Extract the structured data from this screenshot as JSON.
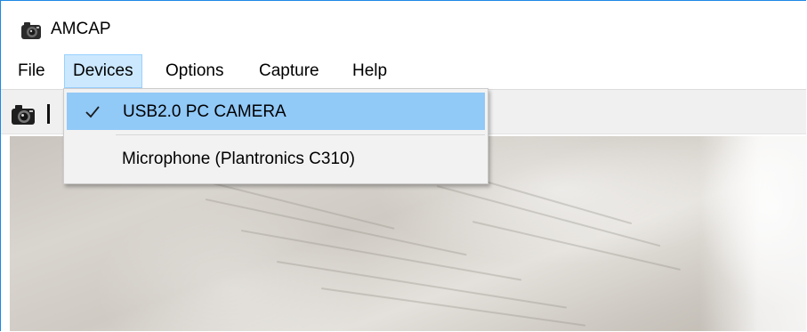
{
  "window": {
    "title": "AMCAP",
    "app_icon": "camera-icon"
  },
  "menubar": {
    "items": [
      {
        "label": "File",
        "active": false
      },
      {
        "label": "Devices",
        "active": true
      },
      {
        "label": "Options",
        "active": false
      },
      {
        "label": "Capture",
        "active": false
      },
      {
        "label": "Help",
        "active": false
      }
    ]
  },
  "toolbar": {
    "button_icon": "camera-capture-icon"
  },
  "devices_menu": {
    "items": [
      {
        "label": "USB2.0 PC CAMERA",
        "checked": true,
        "highlighted": true
      },
      {
        "label": "Microphone (Plantronics C310)",
        "checked": false,
        "highlighted": false
      }
    ]
  },
  "colors": {
    "accent_border": "#1e88e5",
    "menu_active_bg": "#cce8ff",
    "dropdown_highlight": "#91c9f7",
    "dropdown_bg": "#f2f2f2"
  }
}
